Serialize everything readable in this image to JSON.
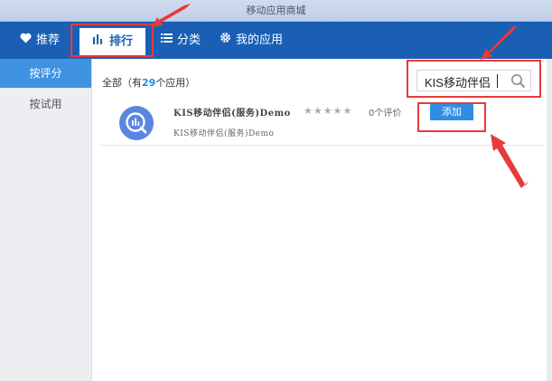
{
  "window": {
    "title": "移动应用商城"
  },
  "nav": {
    "recommend_label": "推荐",
    "ranking_label": "排行",
    "category_label": "分类",
    "myapps_label": "我的应用"
  },
  "sidebar": {
    "items": [
      {
        "label": "按评分",
        "active": true
      },
      {
        "label": "按试用",
        "active": false
      }
    ]
  },
  "main": {
    "count_prefix": "全部（有",
    "count_value": "29",
    "count_suffix": "个应用）",
    "search_value": "KIS移动伴侣",
    "apps": [
      {
        "title": "KIS移动伴侣(服务)Demo",
        "subtitle": "KIS移动伴侣(服务)Demo",
        "stars": "★★★★★",
        "reviews": "0个评价",
        "add_label": "添加"
      }
    ]
  },
  "colors": {
    "nav_bg": "#1b5fb4",
    "accent": "#2f8de4",
    "sidebar_active": "#3f93e0",
    "annotation_red": "#e8393b"
  }
}
